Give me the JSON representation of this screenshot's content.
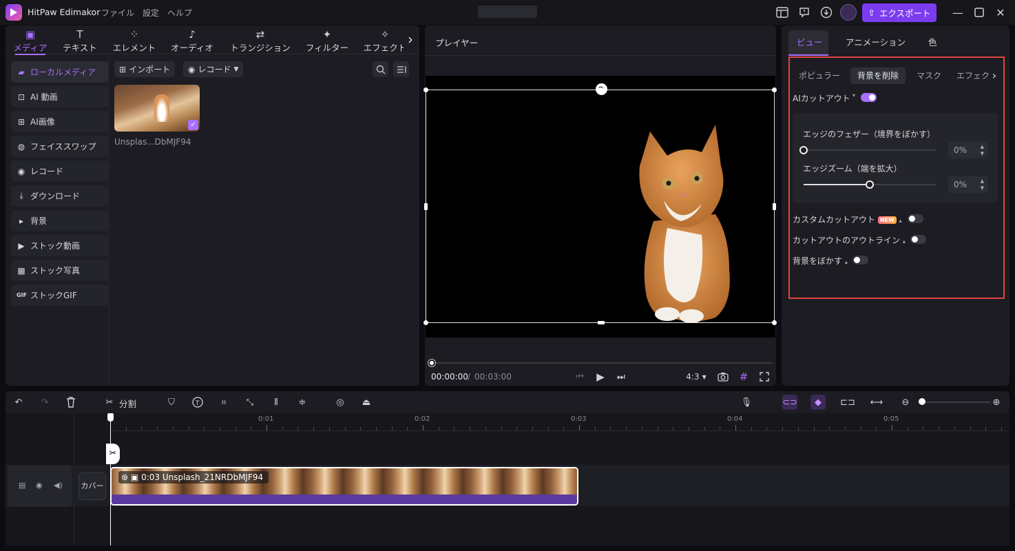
{
  "app": {
    "title": "HitPaw Edimakor",
    "menu": [
      "ファイル",
      "設定",
      "ヘルプ"
    ],
    "export_label": "エクスポート",
    "accent": "#a970ff"
  },
  "left": {
    "tabs": [
      {
        "label": "メディア",
        "icon": "media-icon"
      },
      {
        "label": "テキスト",
        "icon": "text-icon"
      },
      {
        "label": "エレメント",
        "icon": "element-icon"
      },
      {
        "label": "オーディオ",
        "icon": "audio-icon"
      },
      {
        "label": "トランジション",
        "icon": "transition-icon"
      },
      {
        "label": "フィルター",
        "icon": "filter-icon"
      },
      {
        "label": "エフェクト",
        "icon": "effect-icon"
      }
    ],
    "nav": [
      {
        "label": "ローカルメディア",
        "icon": "folder-icon"
      },
      {
        "label": "AI 動画",
        "icon": "ai-video-icon"
      },
      {
        "label": "AI画像",
        "icon": "ai-image-icon"
      },
      {
        "label": "フェイススワップ",
        "icon": "face-swap-icon"
      },
      {
        "label": "レコード",
        "icon": "record-icon"
      },
      {
        "label": "ダウンロード",
        "icon": "download-icon"
      },
      {
        "label": "背景",
        "icon": "caret-right-icon"
      },
      {
        "label": "ストック動画",
        "icon": "play-icon"
      },
      {
        "label": "ストック写真",
        "icon": "photo-icon"
      },
      {
        "label": "ストックGIF",
        "icon": "gif-icon"
      }
    ],
    "import_label": "インポート",
    "record_label": "レコード",
    "media_item_name": "Unsplas...DbMJF94"
  },
  "player": {
    "title": "プレイヤー",
    "time_current": "00:00:00",
    "time_separator": "/",
    "time_total": "00:03:00",
    "aspect": "4:3"
  },
  "right": {
    "tabs": [
      "ビュー",
      "アニメーション",
      "色"
    ],
    "subtabs": [
      "ポピュラー",
      "背景を削除",
      "マスク",
      "エフェクト"
    ],
    "ai_cutout_label": "AIカットアウト",
    "ai_cutout_on": true,
    "feather_label": "エッジのフェザー（境界をぼかす）",
    "feather_value": "0%",
    "feather_level": 0,
    "zoom_label": "エッジズーム（端を拡大）",
    "zoom_value": "0%",
    "zoom_level": 0.5,
    "custom_cutout_label": "カスタムカットアウト",
    "new_badge": "NEW",
    "custom_cutout_on": false,
    "outline_label": "カットアウトのアウトライン",
    "outline_on": false,
    "blur_bg_label": "背景をぼかす",
    "blur_bg_on": false
  },
  "timeline": {
    "split_label": "分割",
    "ruler": [
      "0:01",
      "0:02",
      "0:03",
      "0:04",
      "0:05"
    ],
    "cover_label": "カバー",
    "clip_label": "0:03  Unsplash_21NRDbMJF94"
  }
}
